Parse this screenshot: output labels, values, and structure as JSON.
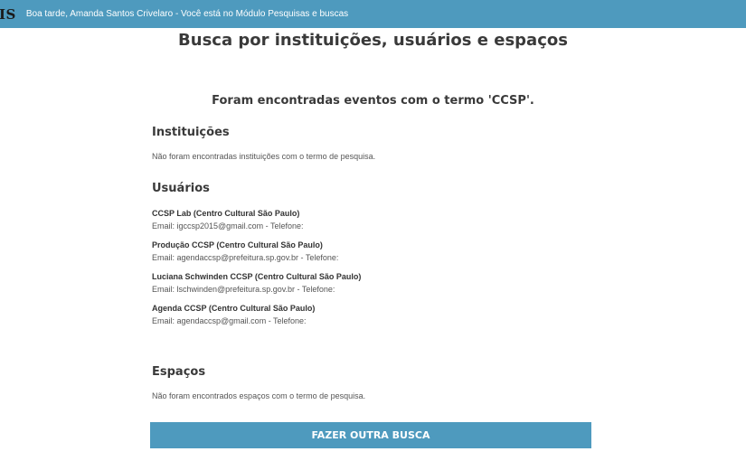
{
  "header": {
    "logo_fragment": "IS",
    "greeting": "Boa tarde, Amanda Santos Crivelaro - Você está no Módulo Pesquisas e buscas"
  },
  "page": {
    "title": "Busca por instituições, usuários e espaços",
    "result_summary": "Foram encontradas eventos com o termo 'CCSP'."
  },
  "sections": {
    "institutions": {
      "heading": "Instituições",
      "empty_note": "Não foram encontradas instituições com o termo de pesquisa."
    },
    "users": {
      "heading": "Usuários",
      "items": [
        {
          "name": "CCSP Lab (Centro Cultural São Paulo)",
          "contact": "Email: igccsp2015@gmail.com - Telefone:"
        },
        {
          "name": "Produção CCSP (Centro Cultural São Paulo)",
          "contact": "Email: agendaccsp@prefeitura.sp.gov.br - Telefone:"
        },
        {
          "name": "Luciana Schwinden CCSP (Centro Cultural São Paulo)",
          "contact": "Email: lschwinden@prefeitura.sp.gov.br - Telefone:"
        },
        {
          "name": "Agenda CCSP (Centro Cultural São Paulo)",
          "contact": "Email: agendaccsp@gmail.com - Telefone:"
        }
      ]
    },
    "spaces": {
      "heading": "Espaços",
      "empty_note": "Não foram encontrados espaços com o termo de pesquisa."
    }
  },
  "actions": {
    "search_again_label": "FAZER OUTRA BUSCA"
  },
  "colors": {
    "accent": "#4e9abe"
  }
}
